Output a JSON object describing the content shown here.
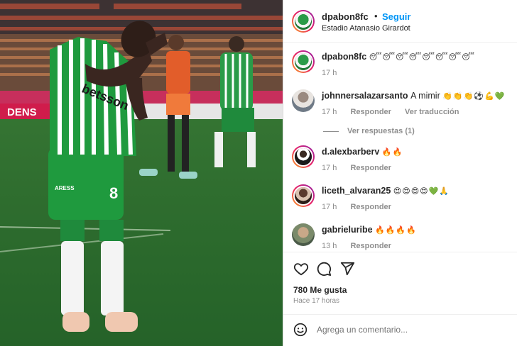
{
  "post": {
    "author": "dpabon8fc",
    "separator": "•",
    "follow_label": "Seguir",
    "location": "Estadio Atanasio Girardot"
  },
  "comments": [
    {
      "user": "dpabon8fc",
      "text": "",
      "emoji": "😴😴😴😴😴😴😴😴",
      "time": "17 h",
      "reply": "",
      "translate": ""
    },
    {
      "user": "johnnersalazarsanto",
      "text": "A mimir",
      "emoji": "👏👏👏⚽💪💚",
      "time": "17 h",
      "reply": "Responder",
      "translate": "Ver traducción"
    },
    {
      "user": "d.alexbarberv",
      "text": "",
      "emoji": "🔥🔥",
      "time": "17 h",
      "reply": "Responder",
      "translate": ""
    },
    {
      "user": "liceth_alvaran25",
      "text": "",
      "emoji": "😍😍😍😍💚🙏",
      "time": "17 h",
      "reply": "Responder",
      "translate": ""
    },
    {
      "user": "gabrieluribe",
      "text": "",
      "emoji": "🔥🔥🔥🔥",
      "time": "13 h",
      "reply": "Responder",
      "translate": ""
    }
  ],
  "replies_label": "Ver respuestas (1)",
  "likes": "780 Me gusta",
  "posted_ago": "Hace 17 horas",
  "comment_placeholder": "Agrega un comentario...",
  "icons": {
    "like": "heart-icon",
    "comment": "comment-icon",
    "share": "share-icon",
    "emoji": "smile-icon"
  },
  "colors": {
    "follow": "#0095f6",
    "muted": "#8e8e8e",
    "jersey_green": "#1f9a3e"
  },
  "photo": {
    "sponsor": "betsson",
    "sponsor2": "ARESS",
    "number": "8",
    "board_text": "DENS"
  }
}
